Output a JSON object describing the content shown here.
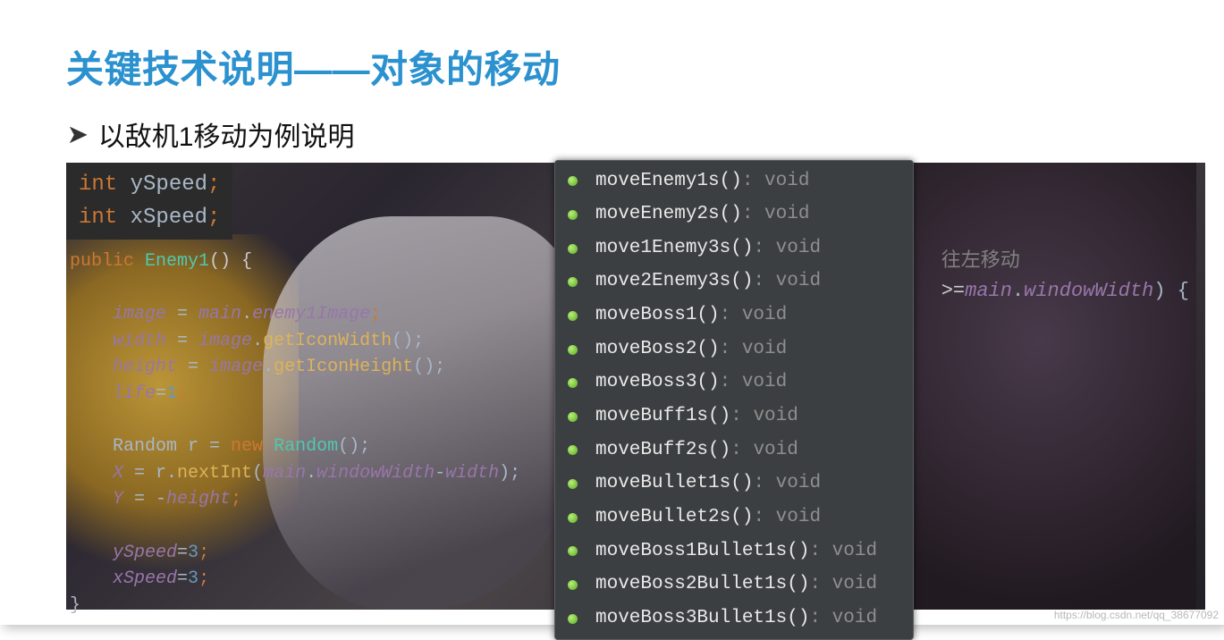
{
  "title": "关键技术说明——对象的移动",
  "bullet": "以敌机1移动为例说明",
  "snippet1": {
    "line1_kw": "int",
    "line1_var": "ySpeed",
    "line2_kw": "int",
    "line2_var": "xSpeed"
  },
  "snippet2": {
    "l0a": "public",
    "l0b": "Enemy1",
    "l0c": "() {",
    "l1a": "image",
    "l1b": " = ",
    "l1c": "main",
    "l1d": ".",
    "l1e": "enemy1Image",
    "l1f": ";",
    "l2a": "width",
    "l2b": " = ",
    "l2c": "image",
    "l2d": ".",
    "l2e": "getIconWidth",
    "l2f": "();",
    "l3a": "height",
    "l3b": " = ",
    "l3c": "image",
    "l3d": ".",
    "l3e": "getIconHeight",
    "l3f": "();",
    "l4a": "life",
    "l4b": "=",
    "l4c": "1",
    "l4d": ";",
    "l5a": "Random",
    "l5b": " r = ",
    "l5c": "new",
    "l5d": " Random",
    "l5e": "();",
    "l6a": "X",
    "l6b": " = r.",
    "l6c": "nextInt",
    "l6d": "(",
    "l6e": "main",
    "l6f": ".",
    "l6g": "windowWidth",
    "l6h": "-",
    "l6i": "width",
    "l6j": ");",
    "l7a": "Y",
    "l7b": " = -",
    "l7c": "height",
    "l7d": ";",
    "l8a": "ySpeed",
    "l8b": "=",
    "l8c": "3",
    "l8d": ";",
    "l9a": "xSpeed",
    "l9b": "=",
    "l9c": "3",
    "l9d": ";",
    "l10": "}"
  },
  "snippet3": {
    "comment": "往左移动",
    "part1": ">=",
    "part2": "main",
    "part3": ".",
    "part4": "windowWidth",
    "part5": ") {"
  },
  "methods": [
    {
      "name": "moveEnemy1s()",
      "ret": " : void"
    },
    {
      "name": "moveEnemy2s()",
      "ret": " : void"
    },
    {
      "name": "move1Enemy3s()",
      "ret": " : void"
    },
    {
      "name": "move2Enemy3s()",
      "ret": " : void"
    },
    {
      "name": "moveBoss1()",
      "ret": " : void"
    },
    {
      "name": "moveBoss2()",
      "ret": " : void"
    },
    {
      "name": "moveBoss3()",
      "ret": " : void"
    },
    {
      "name": "moveBuff1s()",
      "ret": " : void"
    },
    {
      "name": "moveBuff2s()",
      "ret": " : void"
    },
    {
      "name": "moveBullet1s()",
      "ret": " : void"
    },
    {
      "name": "moveBullet2s()",
      "ret": " : void"
    },
    {
      "name": "moveBoss1Bullet1s()",
      "ret": " : void"
    },
    {
      "name": "moveBoss2Bullet1s()",
      "ret": " : void"
    },
    {
      "name": "moveBoss3Bullet1s()",
      "ret": " : void"
    }
  ],
  "watermark": "https://blog.csdn.net/qq_38677092"
}
